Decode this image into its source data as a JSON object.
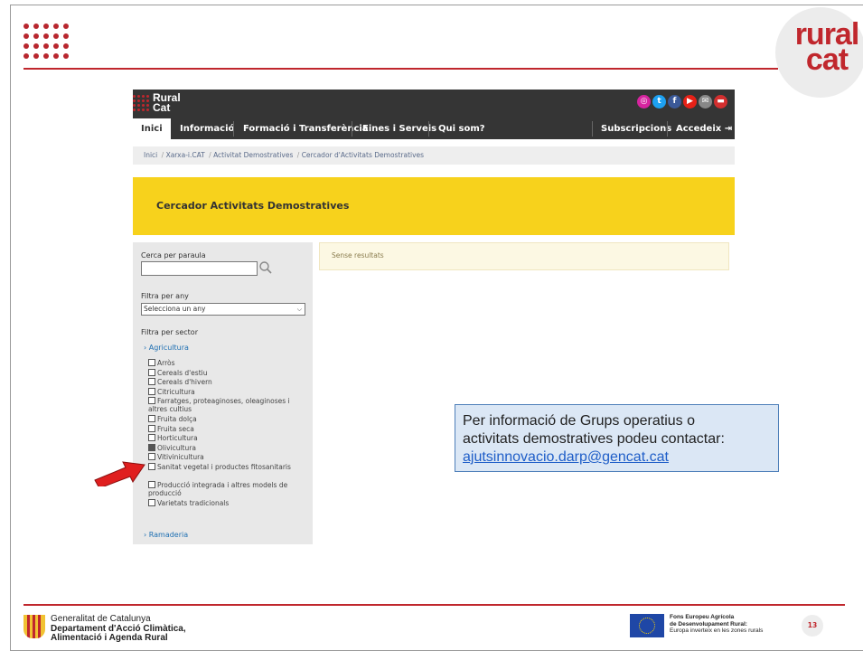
{
  "slide": {
    "brand": {
      "line1": "rural",
      "line2": "cat"
    },
    "page_number": "13",
    "accent_color": "#c0272d"
  },
  "site": {
    "logo": {
      "line1": "Rural",
      "line2": "Cat"
    },
    "social_icons": [
      "instagram-icon",
      "twitter-icon",
      "facebook-icon",
      "youtube-icon",
      "email-icon",
      "print-icon"
    ],
    "nav": {
      "items": [
        "Inici",
        "Informació",
        "Formació i Transferència",
        "Eines i Serveis",
        "Qui som?"
      ],
      "right": [
        "Subscripcions",
        "Accedeix"
      ]
    },
    "breadcrumb": [
      "Inici",
      "Xarxa-i.CAT",
      "Activitat Demostratives",
      "Cercador d'Activitats Demostratives"
    ],
    "banner_title": "Cercador Activitats Demostratives",
    "filters": {
      "search_label": "Cerca per paraula",
      "search_value": "",
      "year_label": "Filtra per any",
      "year_selected": "Selecciona un any",
      "sector_label": "Filtra per sector",
      "category_open": "Agricultura",
      "options": [
        {
          "label": "Arròs",
          "checked": false
        },
        {
          "label": "Cereals d'estiu",
          "checked": false
        },
        {
          "label": "Cereals d'hivern",
          "checked": false
        },
        {
          "label": "Citricultura",
          "checked": false
        },
        {
          "label": "Farratges, proteaginoses, oleaginoses i altres cultius",
          "checked": false
        },
        {
          "label": "Fruita dolça",
          "checked": false
        },
        {
          "label": "Fruita seca",
          "checked": false
        },
        {
          "label": "Horticultura",
          "checked": false
        },
        {
          "label": "Olivicultura",
          "checked": true
        },
        {
          "label": "Vitivinicultura",
          "checked": false
        },
        {
          "label": "Sanitat vegetal i productes fitosanitaris",
          "checked": false
        },
        {
          "label": "Producció integrada i altres models de producció",
          "checked": false
        },
        {
          "label": "Varietats tradicionals",
          "checked": false
        }
      ],
      "category_closed": "Ramaderia"
    },
    "results_text": "Sense resultats"
  },
  "callout": {
    "line1": "Per informació de Grups operatius o",
    "line2": "activitats demostratives podeu contactar:",
    "email": "ajutsinnovacio.darp@gencat.cat"
  },
  "footer": {
    "gen_line1": "Generalitat de Catalunya",
    "gen_line2": "Departament d'Acció Climàtica,",
    "gen_line3": "Alimentació i Agenda Rural",
    "feader_line1": "Fons Europeu Agrícola",
    "feader_line2": "de Desenvolupament Rural:",
    "feader_line3": "Europa inverteix en les zones rurals"
  }
}
